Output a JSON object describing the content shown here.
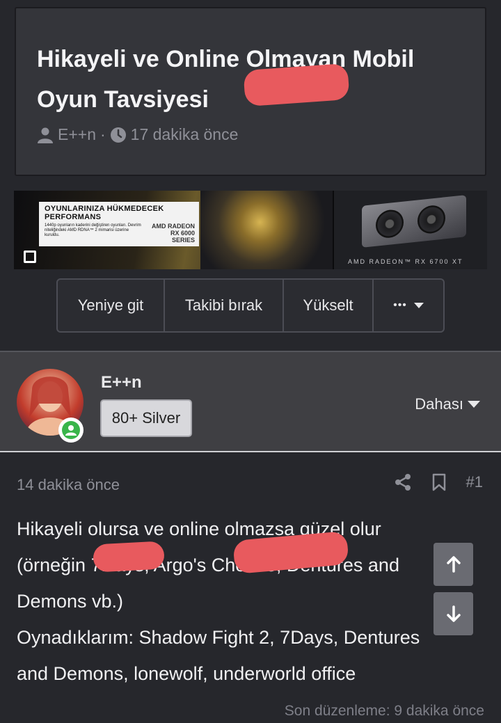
{
  "topic": {
    "title": "Hikayeli ve Online Olmayan Mobil Oyun Tavsiyesi",
    "author": "E++n",
    "separator": "·",
    "time_ago": "17 dakika önce"
  },
  "banner": {
    "headline": "OYUNLARINIZA HÜKMEDECEK PERFORMANS",
    "subtext": "1440p oyunların kaderini değiştiren oyunları. Devrim niteliğindeki AMD RDNA™ 2 mimarisi üzerine kuruldu.",
    "brand": "AMD RADEON RX 6000 SERIES",
    "caption": "AMD RADEON™ RX 6700 XT"
  },
  "actions": {
    "newest": "Yeniye git",
    "unfollow": "Takibi bırak",
    "bump": "Yükselt",
    "more": "•••"
  },
  "post": {
    "author": "E++n",
    "rank": "80+ Silver",
    "more_label": "Dahası",
    "time_ago": "14 dakika önce",
    "number": "#1",
    "body_lines": [
      "Hikayeli olursa ve online olmazsa güzel olur",
      "(örneğin 7Days, Argo's Choose, Dentures and",
      "Demons vb.)",
      "Oynadıklarım: Shadow Fight 2, 7Days, Dentures",
      "and Demons, lonewolf, underworld office"
    ],
    "edit_note": "Son düzenleme: 9 dakika önce"
  },
  "colors": {
    "background": "#26272c",
    "card": "#34353a",
    "redaction": "#e85a5e",
    "online": "#39b54a"
  }
}
